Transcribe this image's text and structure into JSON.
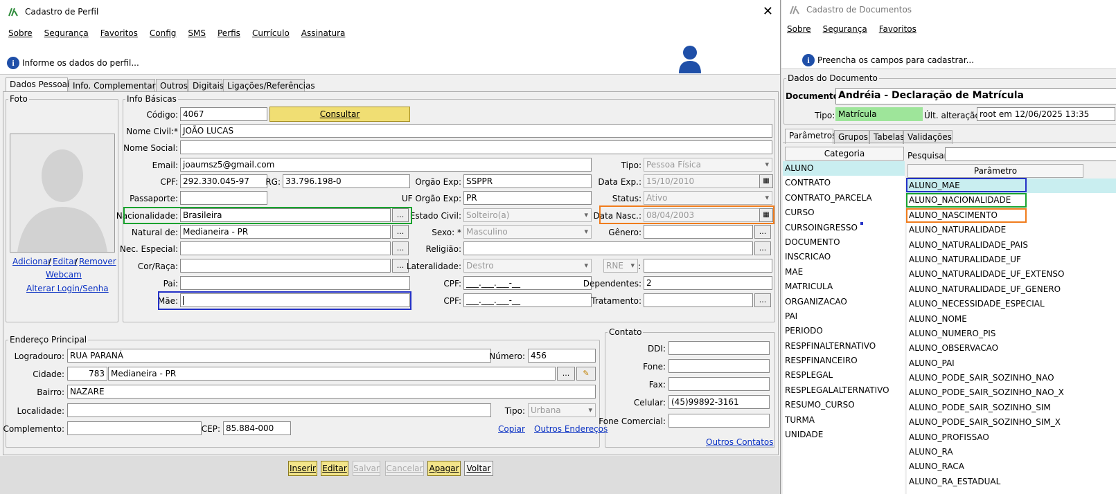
{
  "profile_window": {
    "title": "Cadastro de Perfil",
    "menu": [
      "Sobre",
      "Segurança",
      "Favoritos",
      "Config",
      "SMS",
      "Perfis",
      "Currículo",
      "Assinatura"
    ],
    "info_text": "Informe os dados do perfil...",
    "tabs": [
      "Dados Pessoais",
      "Info. Complementares",
      "Outros",
      "Digitais",
      "Ligações/Referências"
    ],
    "foto": {
      "legend": "Foto",
      "adicionar": "Adicionar",
      "editar": "Editar",
      "remover": "Remover",
      "sep": "/",
      "webcam": "Webcam",
      "alterar_login": "Alterar Login/Senha"
    },
    "info_basicas": {
      "legend": "Info Básicas",
      "codigo_label": "Código:",
      "codigo": "4067",
      "consultar": "Consultar",
      "nome_civil_label": "Nome Civil:*",
      "nome_civil": "JOÃO LUCAS",
      "nome_social_label": "Nome Social:",
      "nome_social": "",
      "email_label": "Email:",
      "email": "joaumsz5@gmail.com",
      "tipo_label": "Tipo:",
      "tipo": "Pessoa Física",
      "cpf_label": "CPF:",
      "cpf": "292.330.045-97",
      "rg_label": "RG:",
      "rg": "33.796.198-0",
      "orgao_label": "Orgão Exp:",
      "orgao": "SSPPR",
      "data_exp_label": "Data Exp.:",
      "data_exp": "15/10/2010",
      "passaporte_label": "Passaporte:",
      "passaporte": "",
      "uf_orgao_label": "UF Orgão Exp:",
      "uf_orgao": "PR",
      "status_label": "Status:",
      "status": "Ativo",
      "nacionalidade_label": "Nacionalidade:",
      "nacionalidade": "Brasileira",
      "estado_civil_label": "Estado Civil:",
      "estado_civil": "Solteiro(a)",
      "data_nasc_label": "Data Nasc.:",
      "data_nasc": "08/04/2003",
      "natural_label": "Natural de:",
      "natural": "Medianeira - PR",
      "sexo_label": "Sexo: *",
      "sexo": "Masculino",
      "genero_label": "Gênero:",
      "genero": "",
      "nec_label": "Nec. Especial:",
      "nec": "",
      "religiao_label": "Religião:",
      "religiao": "",
      "cor_label": "Cor/Raça:",
      "cor": "",
      "lateralidade_label": "Lateralidade:",
      "lateralidade": "Destro",
      "rne": "RNE",
      "colon": ":",
      "pai_label": "Pai:",
      "pai": "",
      "cpf2_label": "CPF:",
      "cpf_mask": "___.___.___-__",
      "dependentes_label": "Dependentes:",
      "dependentes": "2",
      "mae_label": "Mãe:",
      "mae": "",
      "cpf3_label": "CPF:",
      "tratamento_label": "Tratamento:",
      "tratamento": "",
      "dots": "..."
    },
    "endereco": {
      "legend": "Endereço Principal",
      "logradouro_label": "Logradouro:",
      "logradouro": "RUA PARANÁ",
      "numero_label": "Número:",
      "numero": "456",
      "cidade_label": "Cidade:",
      "cidade_cod": "783",
      "cidade": "Medianeira - PR",
      "bairro_label": "Bairro:",
      "bairro": "NAZARE",
      "localidade_label": "Localidade:",
      "localidade": "",
      "tipo_label": "Tipo:",
      "tipo": "Urbana",
      "complemento_label": "Complemento:",
      "complemento": "",
      "cep_label": "CEP:",
      "cep": "85.884-000",
      "copiar": "Copiar",
      "outros_enderecos": "Outros Endereços"
    },
    "contato": {
      "legend": "Contato",
      "ddi_label": "DDI:",
      "fone_label": "Fone:",
      "fax_label": "Fax:",
      "celular_label": "Celular:",
      "celular": "(45)99892-3161",
      "fone_com_label": "Fone Comercial:",
      "outros_contatos": "Outros Contatos"
    },
    "buttons": [
      "Inserir",
      "Editar",
      "Salvar",
      "Cancelar",
      "Apagar",
      "Voltar"
    ]
  },
  "doc_window": {
    "title": "Cadastro de Documentos",
    "menu": [
      "Sobre",
      "Segurança",
      "Favoritos"
    ],
    "info_text": "Preencha os campos para cadastrar...",
    "dados_legend": "Dados do Documento",
    "documento_label": "Documento:",
    "documento": "Andréia - Declaração de Matrícula",
    "tipo_label": "Tipo:",
    "tipo": "Matrícula",
    "ult_label": "Últ. alteração:",
    "ult": "root em 12/06/2025 13:35",
    "tabs": [
      "Parâmetros",
      "Grupos",
      "Tabelas",
      "Validações"
    ],
    "categoria_header": "Categoria",
    "categorias": [
      "ALUNO",
      "CONTRATO",
      "CONTRATO_PARCELA",
      "CURSO",
      "CURSOINGRESSO",
      "DOCUMENTO",
      "INSCRICAO",
      "MAE",
      "MATRICULA",
      "ORGANIZACAO",
      "PAI",
      "PERIODO",
      "RESPFINALTERNATIVO",
      "RESPFINANCEIRO",
      "RESPLEGAL",
      "RESPLEGALALTERNATIVO",
      "RESUMO_CURSO",
      "TURMA",
      "UNIDADE"
    ],
    "pesquisar_label": "Pesquisar:",
    "parametro_header": "Parâmetro",
    "parametros": [
      "ALUNO_MAE",
      "ALUNO_NACIONALIDADE",
      "ALUNO_NASCIMENTO",
      "ALUNO_NATURALIDADE",
      "ALUNO_NATURALIDADE_PAIS",
      "ALUNO_NATURALIDADE_UF",
      "ALUNO_NATURALIDADE_UF_EXTENSO",
      "ALUNO_NATURALIDADE_UF_GENERO",
      "ALUNO_NECESSIDADE_ESPECIAL",
      "ALUNO_NOME",
      "ALUNO_NUMERO_PIS",
      "ALUNO_OBSERVACAO",
      "ALUNO_PAI",
      "ALUNO_PODE_SAIR_SOZINHO_NAO",
      "ALUNO_PODE_SAIR_SOZINHO_NAO_X",
      "ALUNO_PODE_SAIR_SOZINHO_SIM",
      "ALUNO_PODE_SAIR_SOZINHO_SIM_X",
      "ALUNO_PROFISSAO",
      "ALUNO_RA",
      "ALUNO_RACA",
      "ALUNO_RA_ESTADUAL"
    ]
  },
  "colors": {
    "green_hl": "#1aa32f",
    "orange_hl": "#f07c1c",
    "blue_hl": "#2431c6",
    "tipo_green": "#9ee59a",
    "list_selected": "#c9eef0",
    "button_yellow": "#f3e58a"
  }
}
